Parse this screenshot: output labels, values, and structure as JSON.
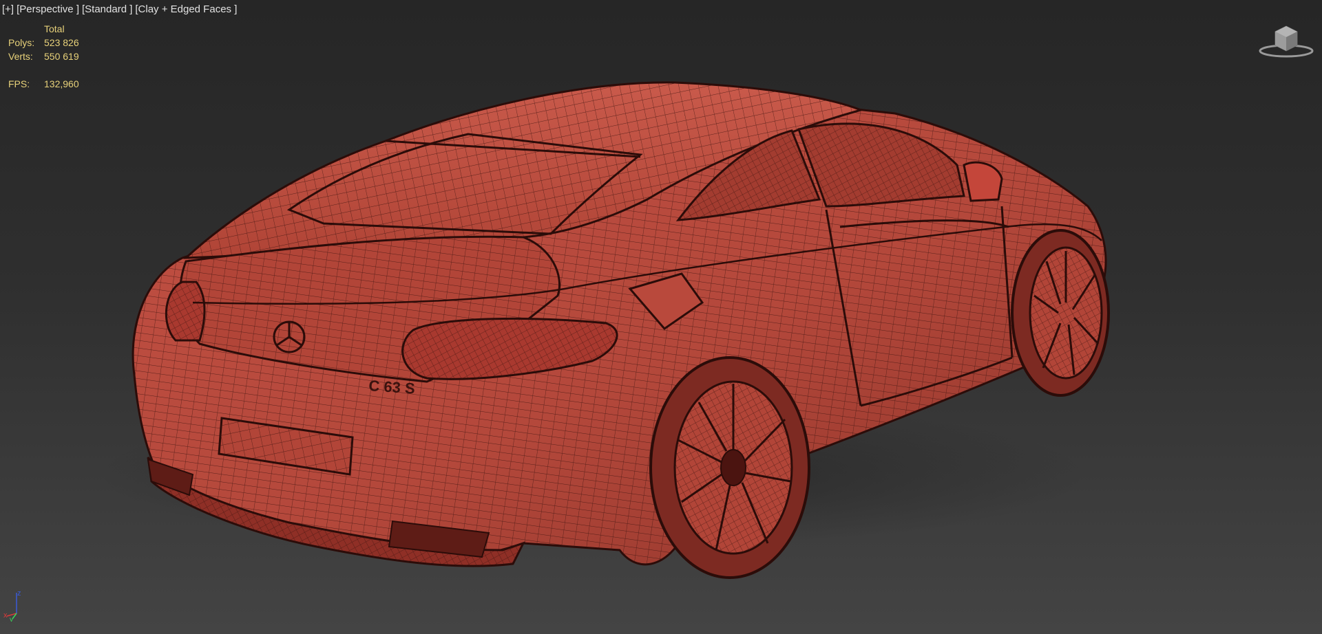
{
  "viewport": {
    "label_parts": [
      "[+]",
      "[Perspective ]",
      "[Standard ]",
      "[Clay + Edged Faces ]"
    ],
    "colors": {
      "background_top": "#262626",
      "background_bottom": "#444444",
      "model_fill": "#b4483b",
      "wireframe": "#3a120e",
      "stats_text": "#e8d27a"
    }
  },
  "stats": {
    "header": "Total",
    "polys_label": "Polys:",
    "polys_value": "523 826",
    "verts_label": "Verts:",
    "verts_value": "550 619",
    "fps_label": "FPS:",
    "fps_value": "132,960"
  },
  "scene": {
    "model_logo_text": "C 63 S"
  },
  "axis_gizmo": {
    "x_label": "x",
    "y_label": "y",
    "z_label": "z"
  },
  "icons": {
    "viewcube": "viewcube-icon",
    "axis": "axis-tripod-icon"
  }
}
